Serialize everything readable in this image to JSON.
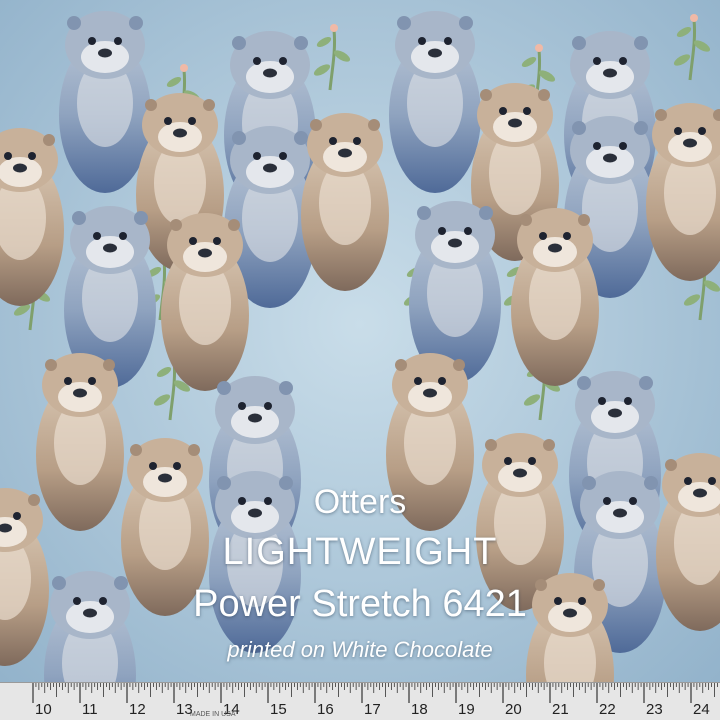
{
  "product": {
    "name": "Otters",
    "weight": "LIGHTWEIGHT",
    "fabric": "Power Stretch 6421",
    "base": "printed on White Chocolate"
  },
  "ruler": {
    "numbers": [
      "10",
      "11",
      "12",
      "13",
      "14",
      "15",
      "16",
      "17",
      "18",
      "19",
      "20",
      "21",
      "22",
      "23",
      "24"
    ],
    "imprint": "MADE IN USA"
  },
  "colors": {
    "background": "#a9c6d9",
    "otter_gray": "#8fa3bf",
    "otter_tan": "#c4ad94",
    "ruler": "#e6e6e6"
  }
}
